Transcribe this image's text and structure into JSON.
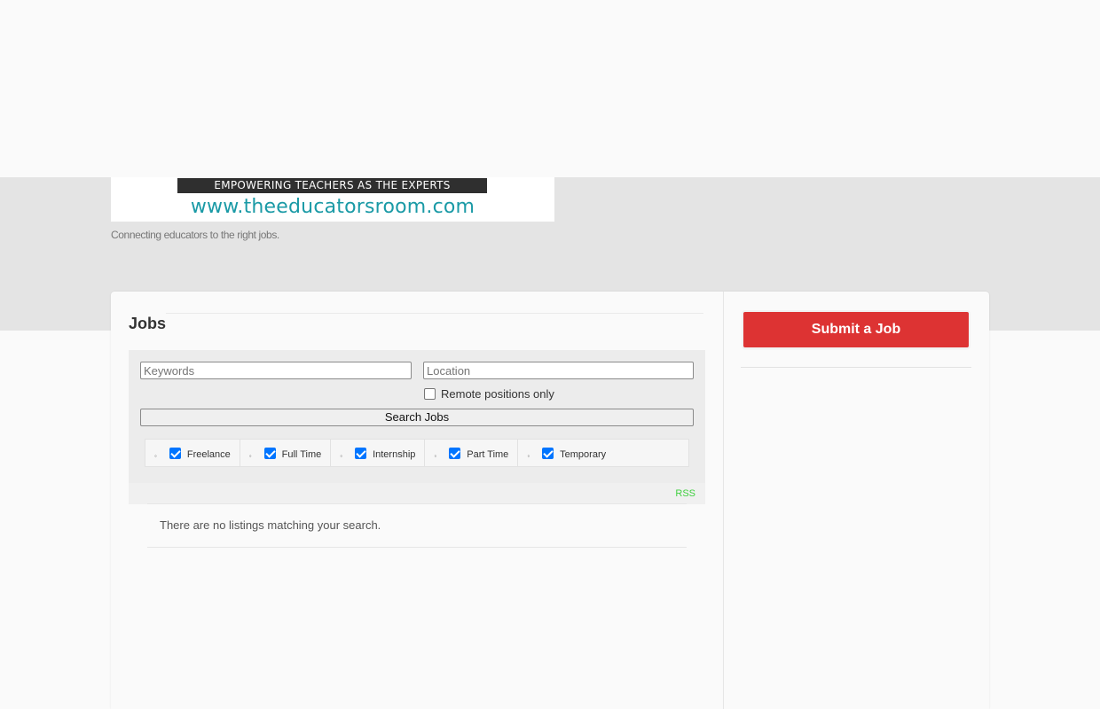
{
  "header": {
    "logo_tagline": "EMPOWERING TEACHERS AS THE EXPERTS",
    "logo_url": "www.theeducatorsroom.com",
    "site_description": "Connecting educators to the right jobs."
  },
  "main": {
    "title": "Jobs",
    "filters": {
      "keywords_placeholder": "Keywords",
      "location_placeholder": "Location",
      "remote_label": "Remote positions only",
      "remote_checked": false,
      "search_button": "Search Jobs",
      "job_types": [
        {
          "label": "Freelance",
          "checked": true
        },
        {
          "label": "Full Time",
          "checked": true
        },
        {
          "label": "Internship",
          "checked": true
        },
        {
          "label": "Part Time",
          "checked": true
        },
        {
          "label": "Temporary",
          "checked": true
        }
      ]
    },
    "rss_label": "RSS",
    "no_results": "There are no listings matching your search."
  },
  "sidebar": {
    "submit_button": "Submit a Job"
  },
  "colors": {
    "accent": "#dd3333",
    "rss": "#3fcf3f",
    "logo_teal": "#1a9aa6",
    "checkbox": "#0075ff"
  }
}
